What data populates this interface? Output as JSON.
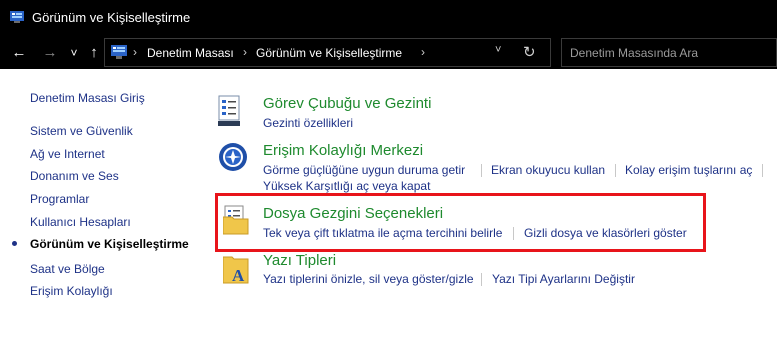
{
  "window": {
    "title": "Görünüm ve Kişiselleştirme"
  },
  "nav": {
    "back_icon": "←",
    "forward_icon": "→",
    "history_icon": "˅",
    "up_icon": "↑"
  },
  "address": {
    "sep1": "›",
    "crumb1": "Denetim Masası",
    "sep2": "›",
    "crumb2": "Görünüm ve Kişiselleştirme",
    "sep3": "›",
    "dropdown_icon": "˅",
    "refresh_icon": "↻"
  },
  "search": {
    "placeholder": "Denetim Masasında Ara"
  },
  "sidebar": {
    "items": [
      {
        "label": "Denetim Masası Giriş"
      },
      {
        "label": "Sistem ve Güvenlik"
      },
      {
        "label": "Ağ ve Internet"
      },
      {
        "label": "Donanım ve Ses"
      },
      {
        "label": "Programlar"
      },
      {
        "label": "Kullanıcı Hesapları"
      },
      {
        "label": "Görünüm ve Kişiselleştirme"
      },
      {
        "label": "Saat ve Bölge"
      },
      {
        "label": "Erişim Kolaylığı"
      }
    ]
  },
  "categories": [
    {
      "title": "Görev Çubuğu ve Gezinti",
      "links": [
        "Gezinti özellikleri"
      ]
    },
    {
      "title": "Erişim Kolaylığı Merkezi",
      "links": [
        "Görme güçlüğüne uygun duruma getir",
        "Ekran okuyucu kullan",
        "Kolay erişim tuşlarını aç",
        "Yüksek Karşıtlığı aç veya kapat"
      ]
    },
    {
      "title": "Dosya Gezgini Seçenekleri",
      "links": [
        "Tek veya çift tıklatma ile açma tercihini belirle",
        "Gizli dosya ve klasörleri göster"
      ]
    },
    {
      "title": "Yazı Tipleri",
      "links": [
        "Yazı tiplerini önizle, sil veya göster/gizle",
        "Yazı Tipi Ayarlarını Değiştir"
      ]
    }
  ],
  "colors": {
    "link": "#1e3287",
    "category_title": "#1e8a2e",
    "highlight": "#e8141a"
  }
}
